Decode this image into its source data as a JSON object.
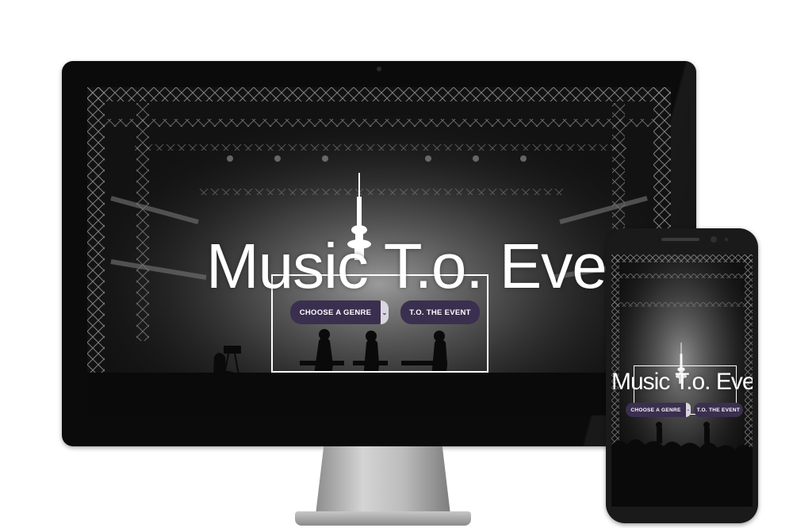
{
  "site": {
    "logo_parts": [
      "Music ",
      "T",
      ".o. Event"
    ],
    "buttons": {
      "choose_genre": "CHOOSE A GENRE",
      "to_the_event": "T.O. THE EVENT"
    }
  },
  "icons": {
    "dropdown": "chevron-down-icon",
    "tower": "cn-tower-icon"
  },
  "colors": {
    "button_bg": "#3b2f4f",
    "chevron_bg": "#d9d6e0",
    "text": "#ffffff"
  }
}
